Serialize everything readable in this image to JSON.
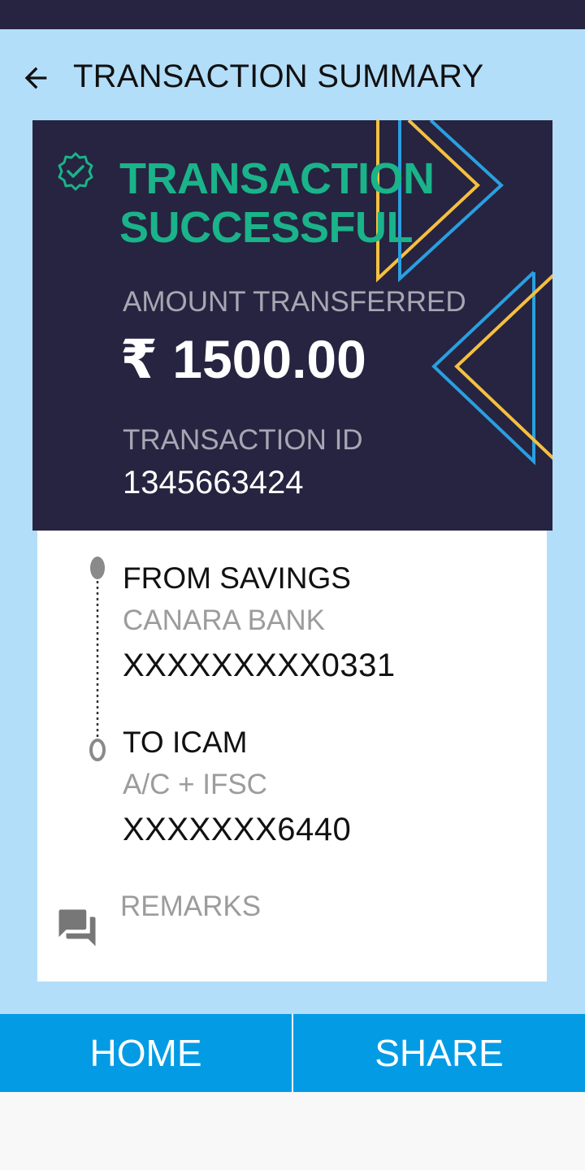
{
  "header": {
    "title": "TRANSACTION SUMMARY",
    "back_icon": "arrow-left-icon"
  },
  "status": {
    "title_line1": "TRANSACTION",
    "title_line2": "SUCCESSFUL",
    "icon": "check-badge-icon",
    "accent_color": "#1ab38a"
  },
  "amount": {
    "label": "AMOUNT TRANSFERRED",
    "value": "₹ 1500.00"
  },
  "transaction": {
    "label": "TRANSACTION ID",
    "id": "1345663424"
  },
  "from": {
    "title": "FROM SAVINGS",
    "bank": "CANARA BANK",
    "account": "XXXXXXXXX0331"
  },
  "to": {
    "title": "TO ICAM",
    "type": "A/C + IFSC",
    "account": "XXXXXXX6440"
  },
  "remarks": {
    "label": "REMARKS",
    "icon": "chat-bubbles-icon"
  },
  "actions": {
    "home": "HOME",
    "share": "SHARE"
  },
  "colors": {
    "status_bar": "#262440",
    "background": "#b3def9",
    "card_dark": "#262440",
    "button": "#049be5",
    "deco_yellow": "#f5c040",
    "deco_blue": "#2a9fe0"
  }
}
